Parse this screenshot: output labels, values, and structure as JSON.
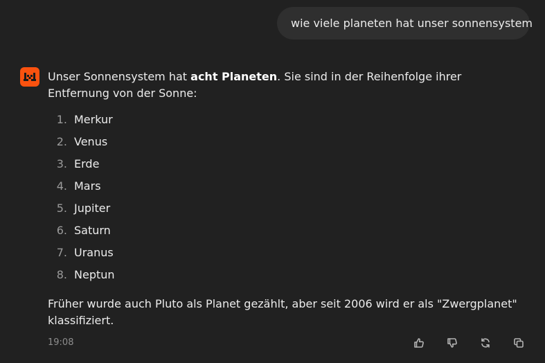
{
  "user_message": {
    "text": "wie viele planeten hat unser sonnensystem"
  },
  "assistant": {
    "avatar_icon": "mistral-logo-icon",
    "accent_color": "#fa520f",
    "intro_before_bold": "Unser Sonnensystem hat ",
    "intro_bold": "acht Planeten",
    "intro_after_bold": ". Sie sind in der Reihenfolge ihrer Entfernung von der Sonne:",
    "planets": [
      {
        "num": "1.",
        "name": "Merkur"
      },
      {
        "num": "2.",
        "name": "Venus"
      },
      {
        "num": "3.",
        "name": "Erde"
      },
      {
        "num": "4.",
        "name": "Mars"
      },
      {
        "num": "5.",
        "name": "Jupiter"
      },
      {
        "num": "6.",
        "name": "Saturn"
      },
      {
        "num": "7.",
        "name": "Uranus"
      },
      {
        "num": "8.",
        "name": "Neptun"
      }
    ],
    "footnote": "Früher wurde auch Pluto als Planet gezählt, aber seit 2006 wird er als \"Zwergplanet\" klassifiziert."
  },
  "footer": {
    "timestamp": "19:08",
    "actions": [
      "thumbs-up-icon",
      "thumbs-down-icon",
      "regenerate-icon",
      "copy-icon"
    ]
  }
}
